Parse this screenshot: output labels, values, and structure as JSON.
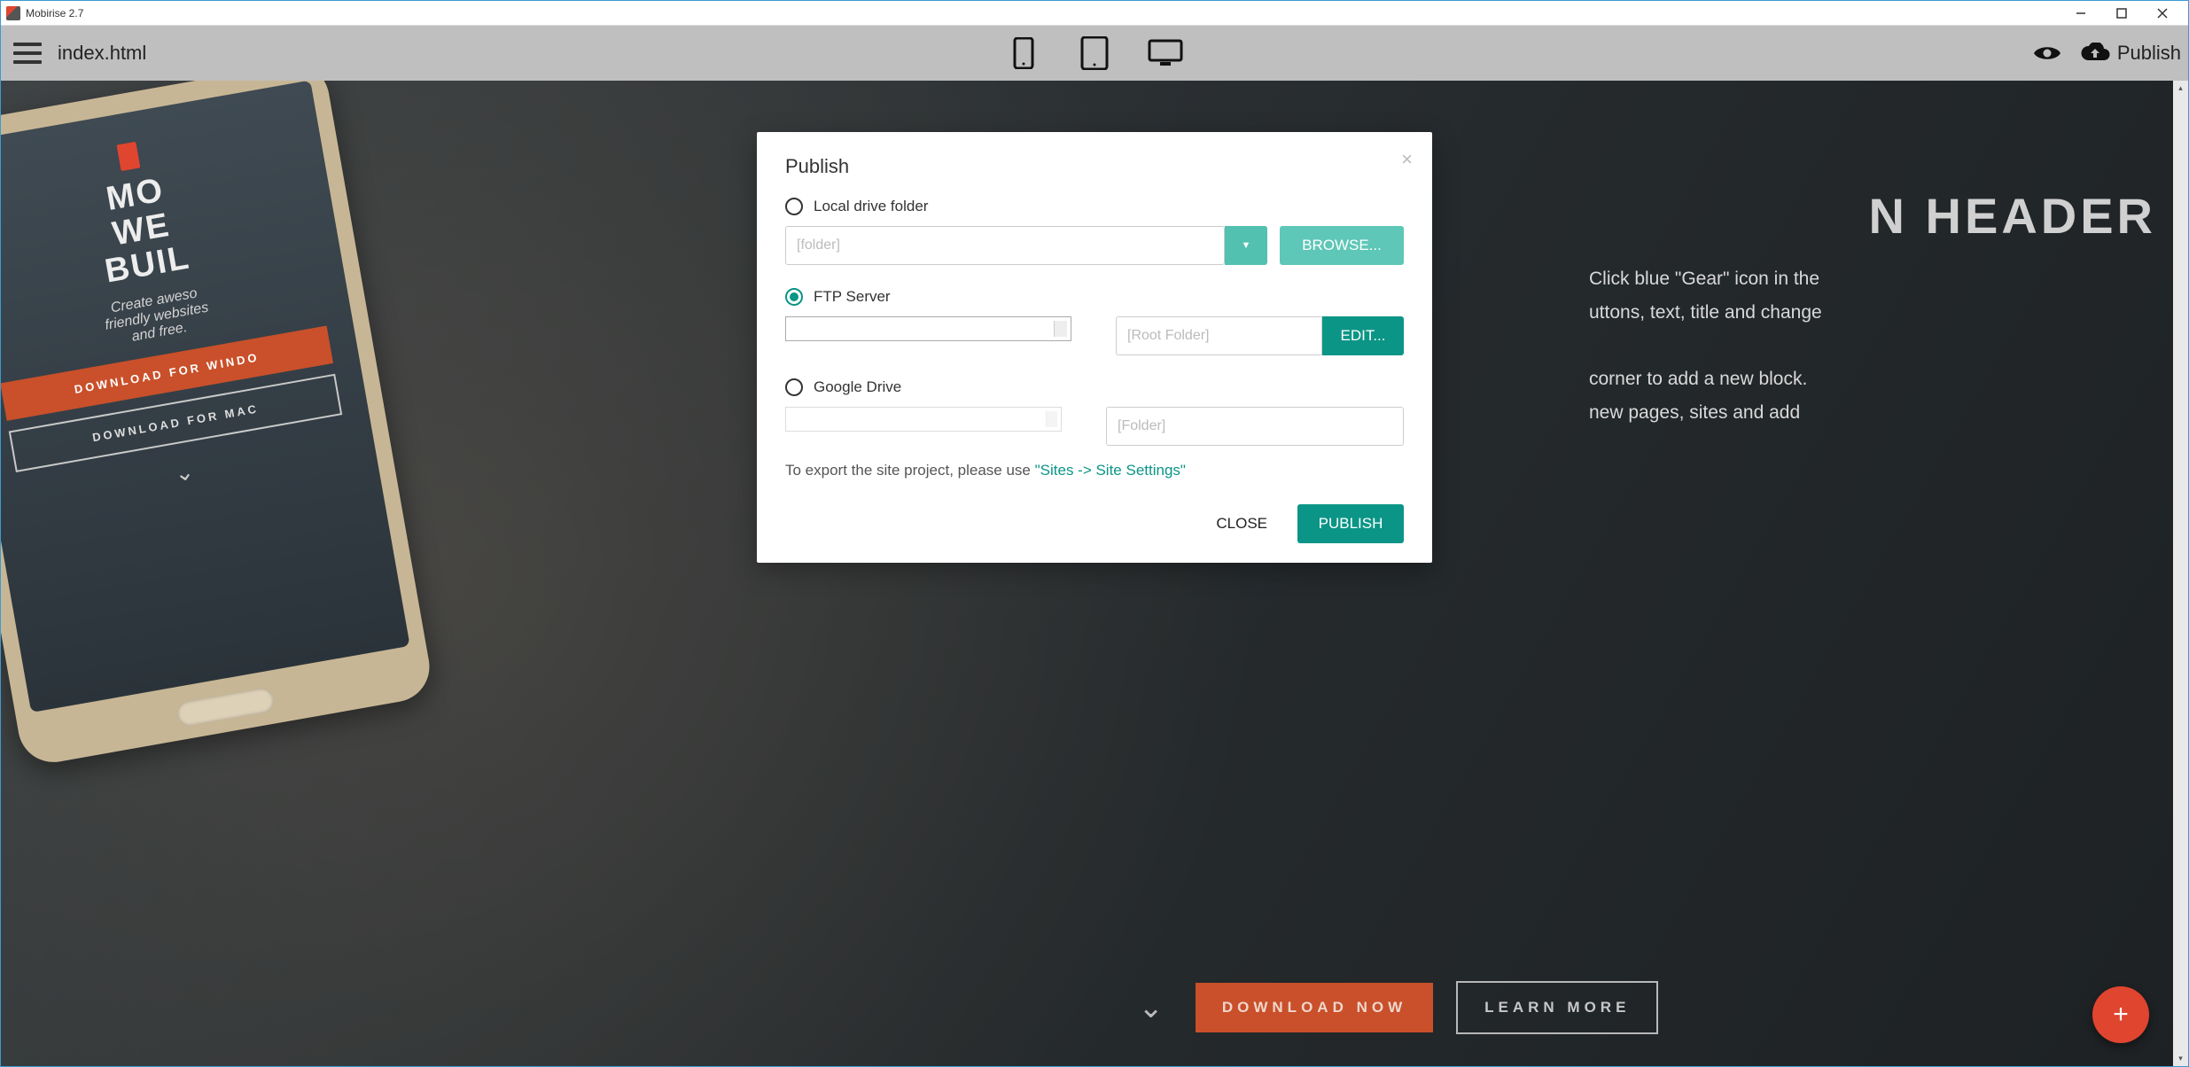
{
  "titlebar": {
    "title": "Mobirise 2.7"
  },
  "toolbar": {
    "page_name": "index.html",
    "publish_label": "Publish"
  },
  "hero": {
    "heading_fragment": "N HEADER",
    "p1": "Click blue \"Gear\" icon in the",
    "p2": "uttons, text, title and change",
    "p3": "corner to add a new block.",
    "p4": "new pages, sites and add",
    "download_now": "DOWNLOAD NOW",
    "learn_more": "LEARN MORE"
  },
  "phone": {
    "headline_l1": "MO",
    "headline_l2": "WE",
    "headline_l3": "BUIL",
    "sub_l1": "Create aweso",
    "sub_l2": "friendly websites",
    "sub_l3": "and free.",
    "btn_primary": "DOWNLOAD FOR WINDO",
    "btn_secondary": "DOWNLOAD FOR MAC"
  },
  "dialog": {
    "title": "Publish",
    "options": {
      "local": {
        "label": "Local drive folder",
        "placeholder": "[folder]",
        "browse": "BROWSE..."
      },
      "ftp": {
        "label": "FTP Server",
        "root_placeholder": "[Root Folder]",
        "edit": "EDIT..."
      },
      "gdrive": {
        "label": "Google Drive",
        "folder_placeholder": "[Folder]"
      }
    },
    "export_note_prefix": "To export the site project, please use ",
    "export_note_link": "\"Sites -> Site Settings\"",
    "close": "CLOSE",
    "publish": "PUBLISH"
  }
}
